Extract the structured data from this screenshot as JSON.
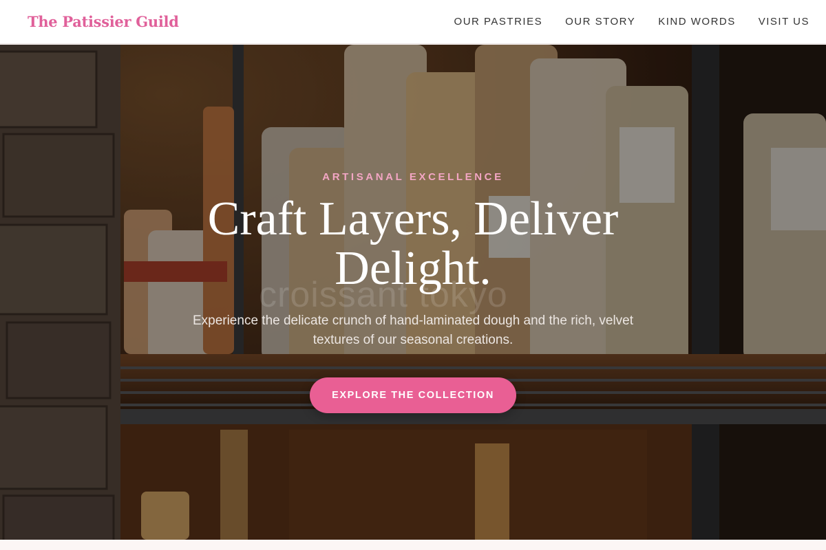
{
  "brand": {
    "name": "The Patissier Guild",
    "color": "#e0609a"
  },
  "nav": {
    "items": [
      {
        "label": "OUR PASTRIES"
      },
      {
        "label": "OUR STORY"
      },
      {
        "label": "KIND WORDS"
      },
      {
        "label": "VISIT US"
      }
    ]
  },
  "hero": {
    "eyebrow": "ARTISANAL EXCELLENCE",
    "headline": "Craft Layers, Deliver Delight.",
    "subtext": "Experience the delicate crunch of hand-laminated dough and the rich, velvet textures of our seasonal creations.",
    "cta_label": "EXPLORE THE COLLECTION",
    "watermark": "croissant tokyo",
    "accent_color": "#e95f94",
    "background_image": "pantry shelves with bagged pasta"
  }
}
